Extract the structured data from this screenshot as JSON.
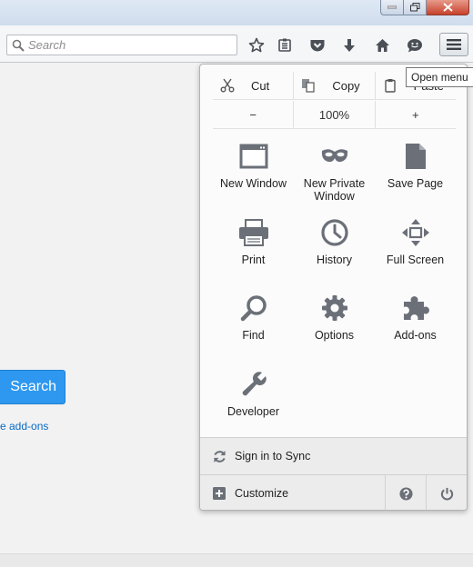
{
  "toolbar": {
    "search_placeholder": "Search"
  },
  "tooltip": "Open menu",
  "page": {
    "search_button": "Search",
    "addons_link": "e add-ons"
  },
  "menu": {
    "edit": {
      "cut": "Cut",
      "copy": "Copy",
      "paste": "Paste"
    },
    "zoom": {
      "out": "−",
      "level": "100%",
      "in": "+"
    },
    "items": [
      {
        "label": "New Window",
        "icon": "new-window-icon"
      },
      {
        "label": "New Private Window",
        "icon": "private-mask-icon"
      },
      {
        "label": "Save Page",
        "icon": "save-page-icon"
      },
      {
        "label": "Print",
        "icon": "printer-icon"
      },
      {
        "label": "History",
        "icon": "clock-icon"
      },
      {
        "label": "Full Screen",
        "icon": "fullscreen-arrows-icon"
      },
      {
        "label": "Find",
        "icon": "magnifier-icon"
      },
      {
        "label": "Options",
        "icon": "gear-icon"
      },
      {
        "label": "Add-ons",
        "icon": "puzzle-icon"
      },
      {
        "label": "Developer",
        "icon": "wrench-icon"
      }
    ],
    "sync": "Sign in to Sync",
    "customize": "Customize"
  },
  "colors": {
    "accent_blue": "#2e98f0",
    "icon_gray": "#6b7078",
    "close_red": "#c7422b"
  }
}
